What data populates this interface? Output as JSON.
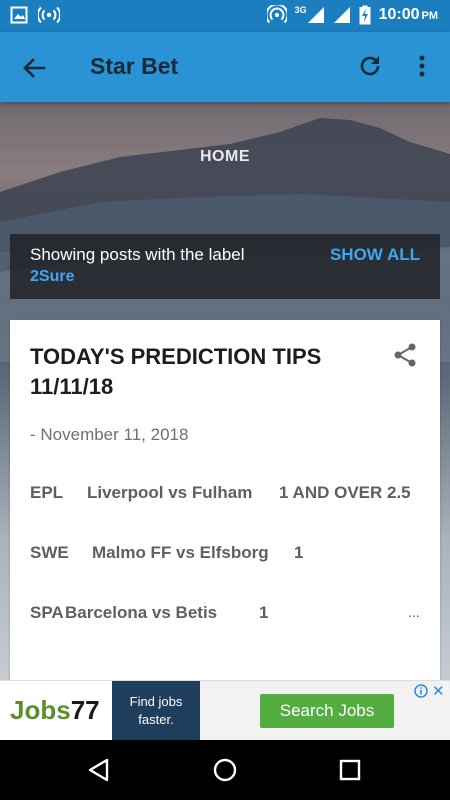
{
  "status_bar": {
    "network": "3G",
    "time": "10:00",
    "ampm": "PM"
  },
  "app_bar": {
    "title": "Star Bet"
  },
  "hero": {
    "home_label": "HOME"
  },
  "label_filter": {
    "text": "Showing posts with the label",
    "label": "2Sure",
    "show_all": "SHOW ALL"
  },
  "post": {
    "title_line1": "TODAY'S PREDICTION TIPS",
    "title_line2": "11/11/18",
    "date": "- November 11, 2018",
    "tips": [
      {
        "league": "EPL",
        "match": "Liverpool vs Fulham",
        "tip": "1 AND OVER 2.5"
      },
      {
        "league": "SWE",
        "match": "Malmo FF vs Elfsborg",
        "tip": "1"
      },
      {
        "league": "SPA",
        "match": "Barcelona vs Betis",
        "tip": "1"
      }
    ],
    "more": "..."
  },
  "ad": {
    "logo_text": "Jobs",
    "logo_num": "77",
    "tagline_1": "Find jobs",
    "tagline_2": "faster.",
    "cta": "Search Jobs",
    "close": "✕",
    "colors": {
      "brand_green": "#5b8f2c",
      "cta_green": "#53ad40",
      "navy": "#1f3d5c"
    }
  },
  "theme": {
    "status_bar": "#1b7fbf",
    "app_bar": "#2a93d5",
    "accent": "#3ea6f2"
  },
  "icons": {
    "status_left": [
      "image-icon",
      "hotspot-icon"
    ],
    "status_right": [
      "wifi-hotspot-icon",
      "signal-icon",
      "signal-icon",
      "battery-charging-icon"
    ],
    "app_bar": [
      "back-arrow-icon",
      "refresh-icon",
      "more-vert-icon"
    ],
    "post": [
      "share-icon"
    ],
    "nav": [
      "back-triangle-icon",
      "home-circle-icon",
      "recents-square-icon"
    ]
  }
}
